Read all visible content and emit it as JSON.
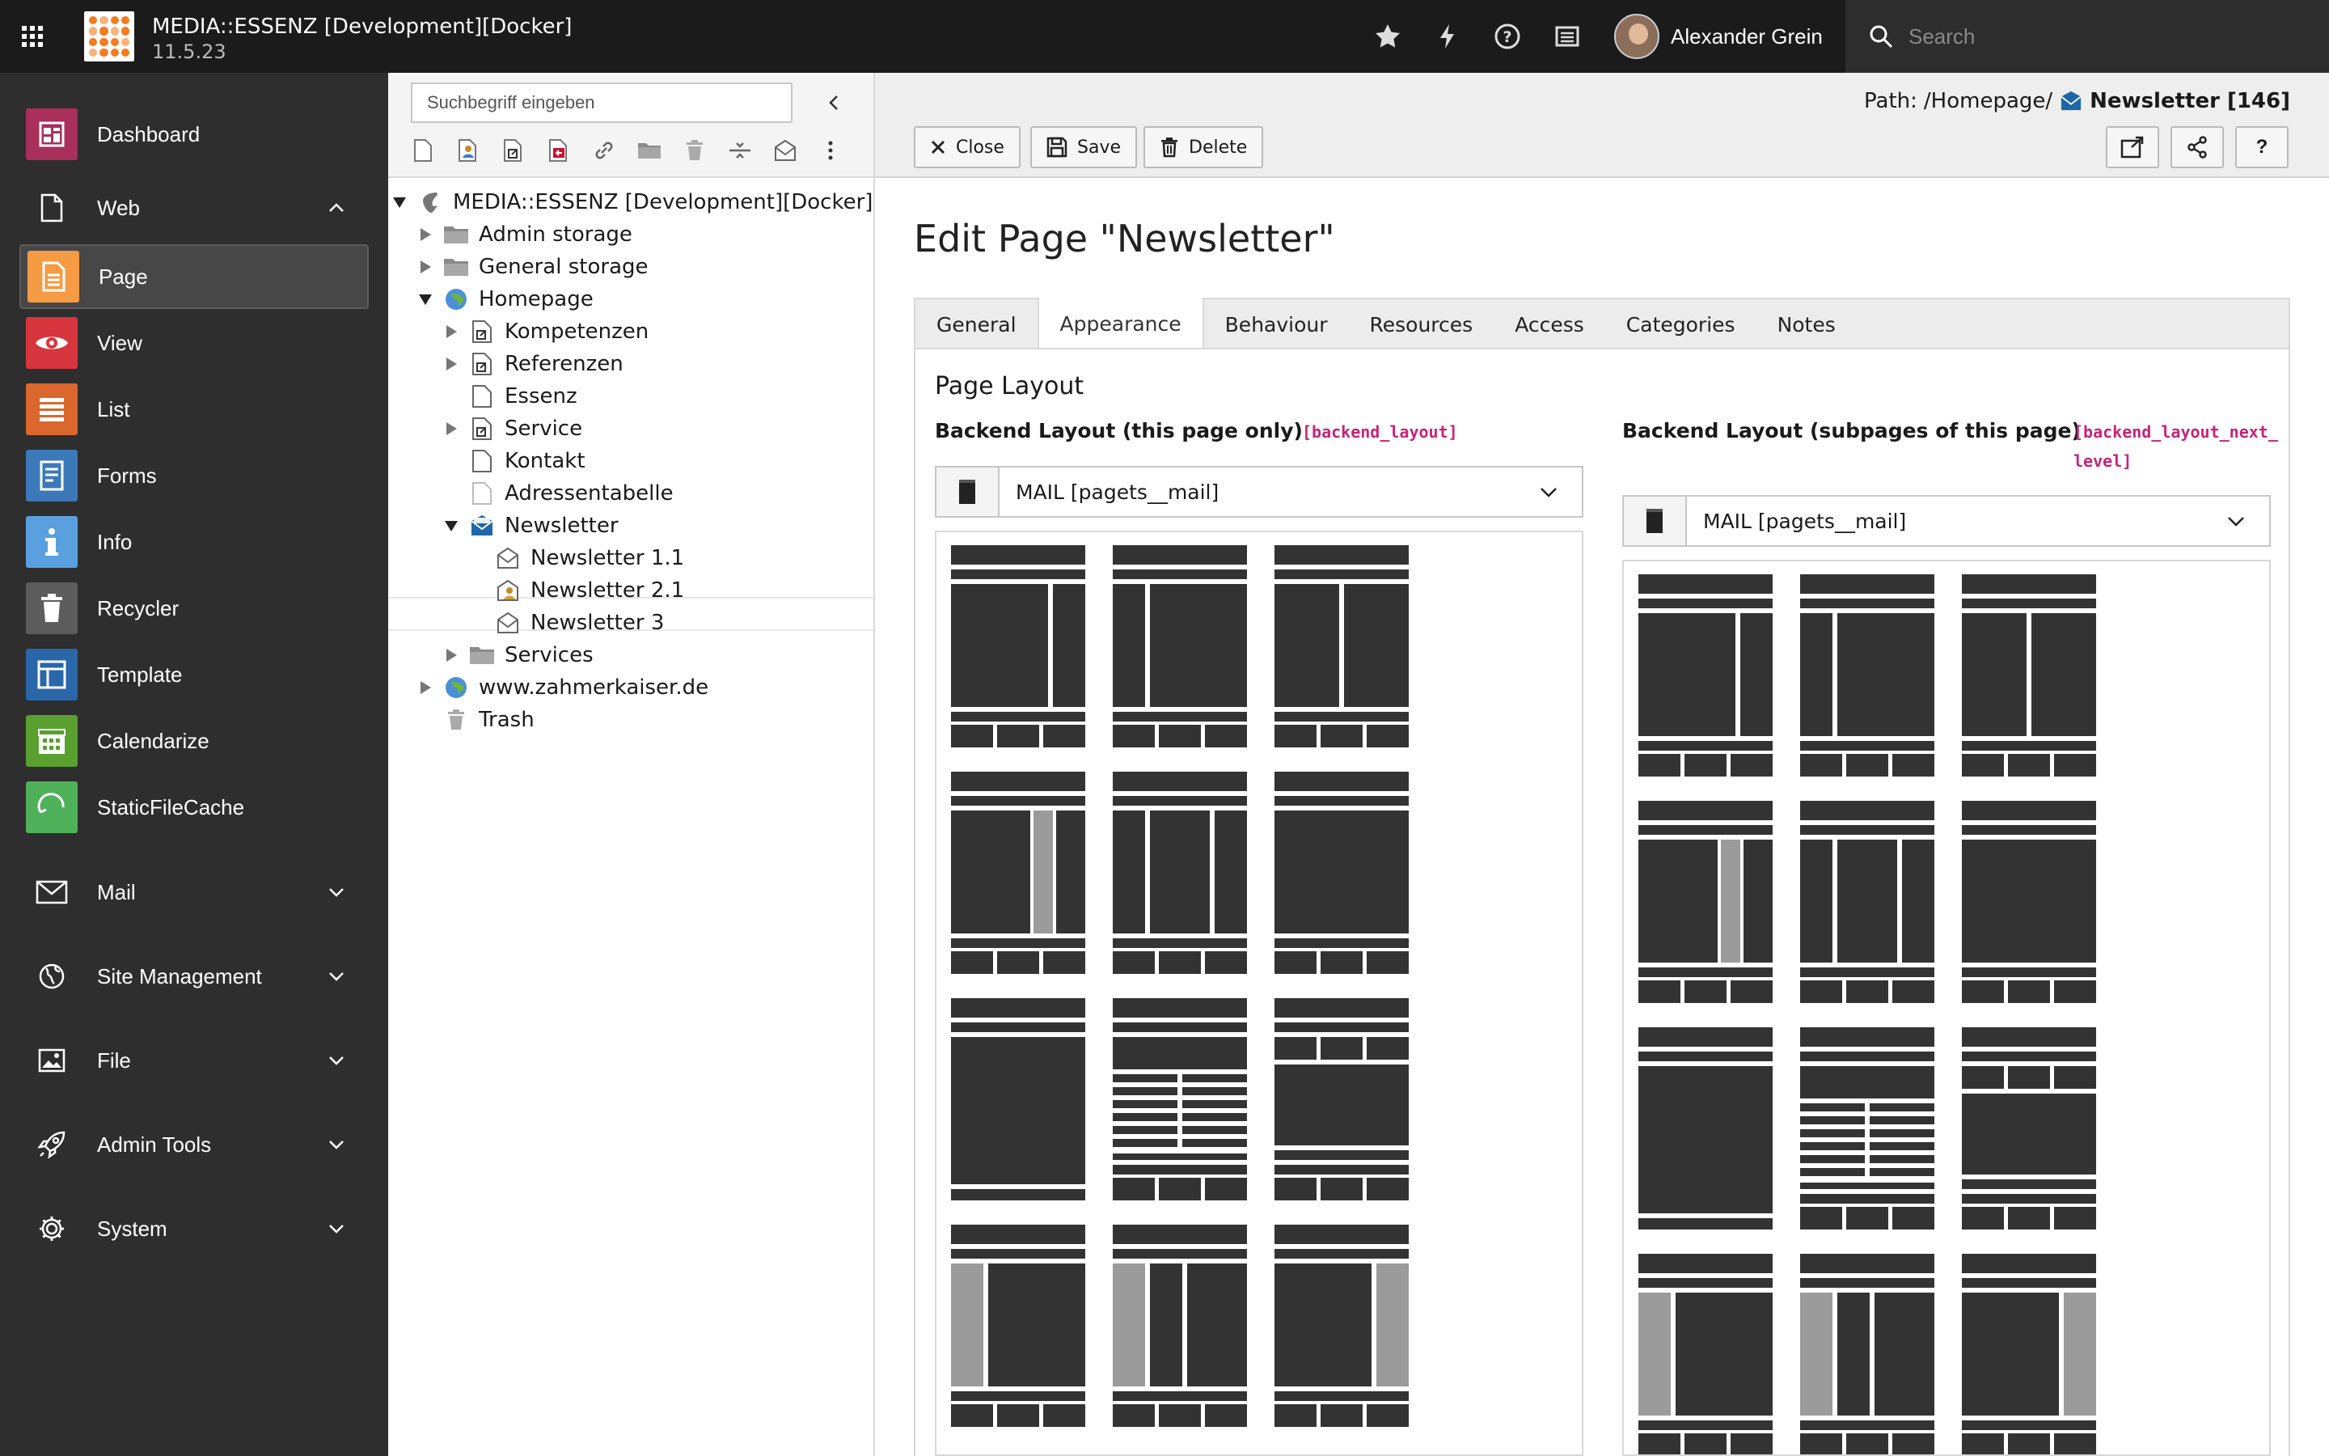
{
  "topbar": {
    "site_title": "MEDIA::ESSENZ [Development][Docker]",
    "version": "11.5.23",
    "user_name": "Alexander Grein",
    "search_placeholder": "Search",
    "icons": [
      "star-icon",
      "bolt-icon",
      "help-icon",
      "list-icon"
    ]
  },
  "modules": {
    "dashboard": "Dashboard",
    "web": "Web",
    "items": [
      {
        "label": "Page",
        "color": "#f49b44",
        "active": true
      },
      {
        "label": "View",
        "color": "#d7353d"
      },
      {
        "label": "List",
        "color": "#d9672e"
      },
      {
        "label": "Forms",
        "color": "#3c79b8"
      },
      {
        "label": "Info",
        "color": "#5aa0de"
      },
      {
        "label": "Recycler",
        "color": "#5c5c5c"
      },
      {
        "label": "Template",
        "color": "#2a67a9"
      },
      {
        "label": "Calendarize",
        "color": "#59a02e"
      },
      {
        "label": "StaticFileCache",
        "color": "#4fb05a"
      }
    ],
    "groups": [
      "Mail",
      "Site Management",
      "File",
      "Admin Tools",
      "System"
    ]
  },
  "tree": {
    "search_placeholder": "Suchbegriff eingeben",
    "root": "MEDIA::ESSENZ [Development][Docker]",
    "nodes": [
      "Admin storage",
      "General storage",
      "Homepage",
      "Kompetenzen",
      "Referenzen",
      "Essenz",
      "Service",
      "Kontakt",
      "Adressentabelle",
      "Newsletter",
      "Newsletter 1.1",
      "Newsletter 2.1",
      "Newsletter 3",
      "Services",
      "www.zahmerkaiser.de",
      "Trash"
    ]
  },
  "docheader": {
    "path_label": "Path:",
    "path_value": "/Homepage/",
    "page_title": "Newsletter [146]",
    "close": "Close",
    "save": "Save",
    "delete": "Delete",
    "help": "?"
  },
  "form": {
    "heading": "Edit Page \"Newsletter\"",
    "tabs": [
      "General",
      "Appearance",
      "Behaviour",
      "Resources",
      "Access",
      "Categories",
      "Notes"
    ],
    "active_tab": "Appearance",
    "legend": "Page Layout",
    "left_label": "Backend Layout (this page only)",
    "left_code": "[backend_layout]",
    "left_value": "MAIL [pagets__mail]",
    "right_label": "Backend Layout (subpages of this page)",
    "right_code": "[backend_layout_next_level]",
    "right_value": "MAIL [pagets__mail]"
  }
}
